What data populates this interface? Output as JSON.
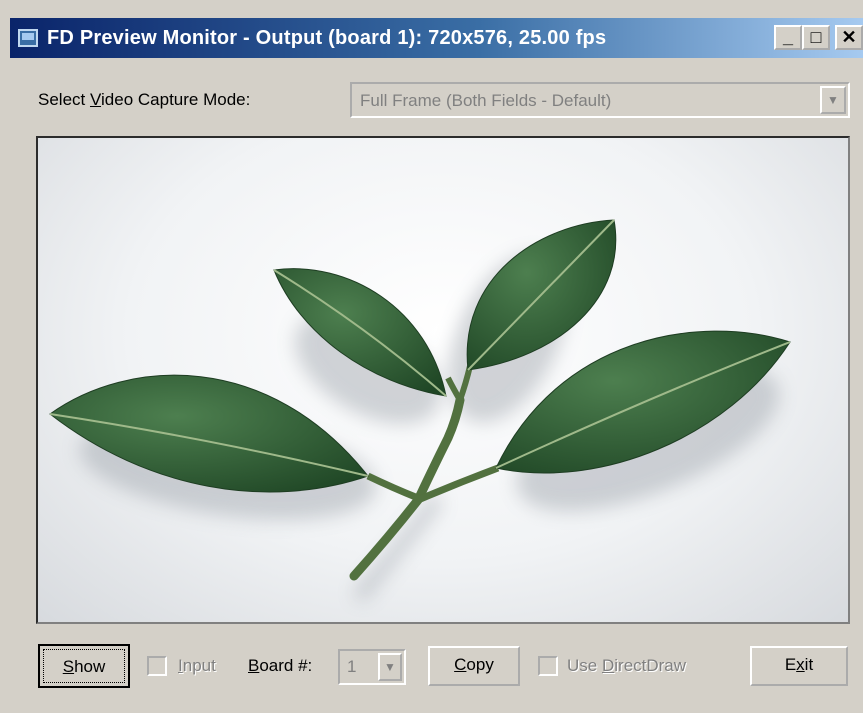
{
  "window": {
    "title": "FD Preview Monitor - Output (board 1): 720x576, 25.00 fps",
    "minimize_label": "_",
    "maximize_label": "□",
    "close_label": "✕"
  },
  "capture_mode": {
    "label_pre": "Select ",
    "label_accel": "V",
    "label_post": "ideo Capture Mode:",
    "value": "Full Frame (Both Fields - Default)",
    "enabled": false,
    "arrow": "▼"
  },
  "preview": {
    "image_subject": "green-leaves-sprig"
  },
  "controls": {
    "show_accel": "S",
    "show_rest": "how",
    "input_accel": "I",
    "input_rest": "nput",
    "input_checked": false,
    "board_accel": "B",
    "board_rest": "oard #:",
    "board_value": "1",
    "board_arrow": "▼",
    "copy_accel": "C",
    "copy_rest": "opy",
    "directdraw_pre": "Use ",
    "directdraw_accel": "D",
    "directdraw_rest": "irectDraw",
    "directdraw_checked": false,
    "exit_pre": "E",
    "exit_accel": "x",
    "exit_rest": "it"
  },
  "colors": {
    "titlebar_start": "#0a246a",
    "titlebar_end": "#a6caf0",
    "face": "#d4d0c8",
    "disabled_text": "#808080",
    "leaf": "#2f5a33"
  }
}
